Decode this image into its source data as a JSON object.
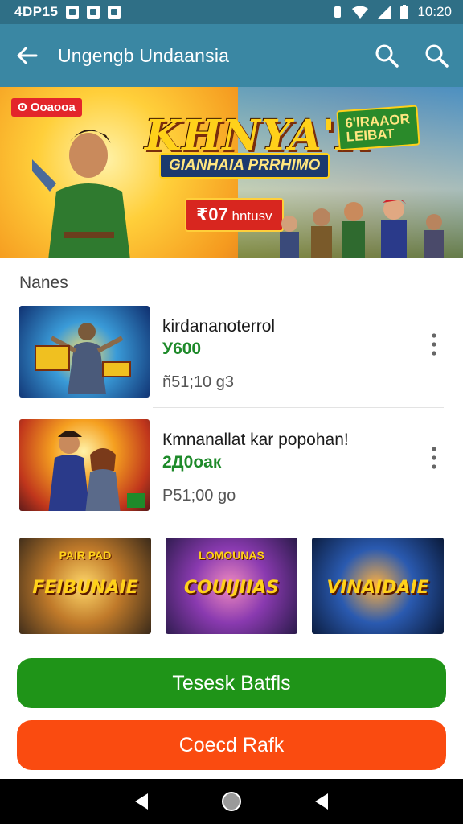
{
  "status_bar": {
    "left_text": "4DP15",
    "time": "10:20"
  },
  "app_bar": {
    "title": "Ungengb Undaansia"
  },
  "banner": {
    "badge": "ʘ Ooaooa",
    "title": "KHNYA'R",
    "subtitle": "GIANHAIA PRRHIMO",
    "promo_number": "₹07",
    "promo_text": "hntusv",
    "corner_line1": "6'IRAAOR",
    "corner_line2": "LEIBAT"
  },
  "section": {
    "label": "Nanes"
  },
  "items": [
    {
      "name": "kirdananoterrol",
      "price": "У600",
      "meta": "ñ51;10 g3"
    },
    {
      "name": "Кmnanallat kar popohan!",
      "price": "2Д0оак",
      "meta": "P51;00 go"
    }
  ],
  "tiles": [
    {
      "top": "PAIR PAD",
      "label": "FEIBUNAIE"
    },
    {
      "top": "LOMOUNAS",
      "label": "COUIJIIAS"
    },
    {
      "top": "",
      "label": "VINAIDAIE"
    }
  ],
  "buttons": {
    "primary": "Tesesk Batfls",
    "secondary": "Coecd Rafk"
  },
  "colors": {
    "app_bar": "#3a87a3",
    "status_bar": "#2f6f86",
    "green": "#1f9418",
    "orange": "#fa4b10"
  }
}
